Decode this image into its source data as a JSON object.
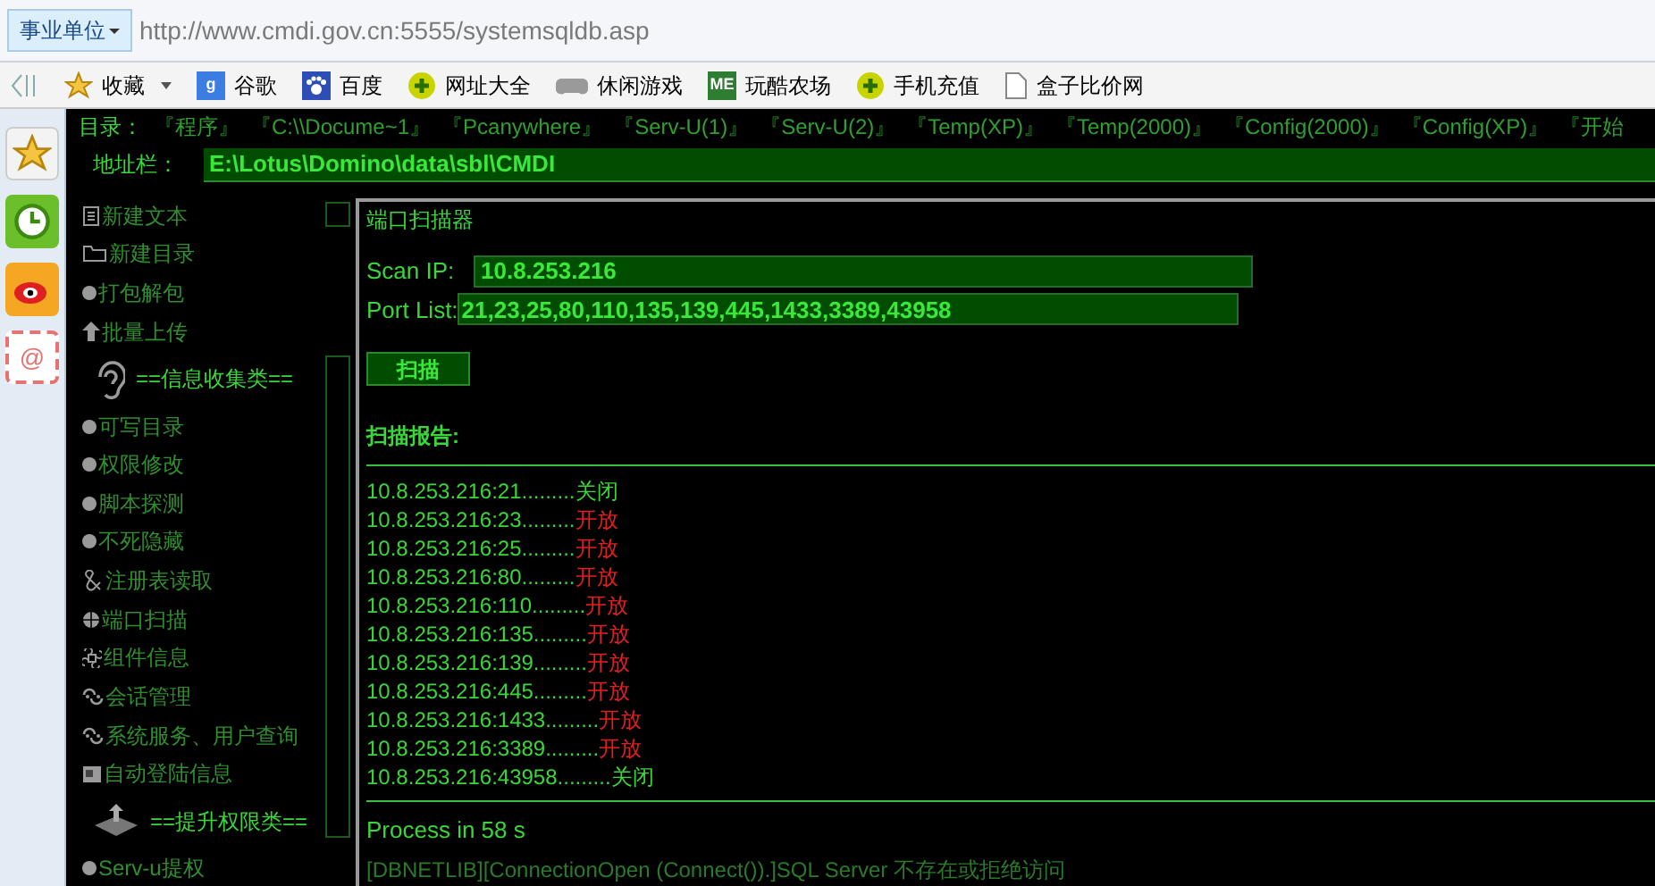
{
  "browser": {
    "zone_button": "事业单位",
    "url": "http://www.cmdi.gov.cn:5555/systemsqldb.asp",
    "bookmarks": [
      {
        "label": "收藏"
      },
      {
        "badge": "g",
        "label": "谷歌"
      },
      {
        "label": "百度"
      },
      {
        "label": "网址大全"
      },
      {
        "label": "休闲游戏"
      },
      {
        "badge": "ME",
        "label": "玩酷农场"
      },
      {
        "label": "手机充值"
      },
      {
        "label": "盒子比价网"
      }
    ]
  },
  "side_rail": {
    "mail_glyph": "@"
  },
  "directory": {
    "label": "目录：",
    "links": [
      "『程序』",
      "『C:\\\\Docume~1』",
      "『Pcanywhere』",
      "『Serv-U(1)』",
      "『Serv-U(2)』",
      "『Temp(XP)』",
      "『Temp(2000)』",
      "『Config(2000)』",
      "『Config(XP)』",
      "『开始"
    ]
  },
  "address": {
    "label": "地址栏：",
    "value": "E:\\Lotus\\Domino\\data\\sbl\\CMDI"
  },
  "sidebar": [
    {
      "kind": "item",
      "label": "新建文本"
    },
    {
      "kind": "item",
      "label": "新建目录"
    },
    {
      "kind": "item",
      "label": "打包解包"
    },
    {
      "kind": "item",
      "label": "批量上传"
    },
    {
      "kind": "header",
      "label": "==信息收集类=="
    },
    {
      "kind": "item",
      "label": "可写目录"
    },
    {
      "kind": "item",
      "label": "权限修改"
    },
    {
      "kind": "item",
      "label": "脚本探测"
    },
    {
      "kind": "item",
      "label": "不死隐藏"
    },
    {
      "kind": "item",
      "label": "注册表读取"
    },
    {
      "kind": "item",
      "label": "端口扫描"
    },
    {
      "kind": "item",
      "label": "组件信息"
    },
    {
      "kind": "item",
      "label": "会话管理"
    },
    {
      "kind": "item",
      "label": "系统服务、用户查询"
    },
    {
      "kind": "item",
      "label": "自动登陆信息"
    },
    {
      "kind": "header",
      "label": "==提升权限类=="
    },
    {
      "kind": "item",
      "label": "Serv-u提权"
    }
  ],
  "scanner": {
    "title": "端口扫描器",
    "scan_ip_label": "Scan IP:",
    "scan_ip": "10.8.253.216",
    "port_list_label": "Port List:",
    "port_list": "21,23,25,80,110,135,139,445,1433,3389,43958",
    "scan_button": "扫描",
    "report_label": "扫描报告:",
    "results": [
      {
        "target": "10.8.253.216:21.........",
        "status": "关闭",
        "kind": "closed"
      },
      {
        "target": "10.8.253.216:23.........",
        "status": "开放",
        "kind": "open"
      },
      {
        "target": "10.8.253.216:25.........",
        "status": "开放",
        "kind": "open"
      },
      {
        "target": "10.8.253.216:80.........",
        "status": "开放",
        "kind": "open"
      },
      {
        "target": "10.8.253.216:110.........",
        "status": "开放",
        "kind": "open"
      },
      {
        "target": "10.8.253.216:135.........",
        "status": "开放",
        "kind": "open"
      },
      {
        "target": "10.8.253.216:139.........",
        "status": "开放",
        "kind": "open"
      },
      {
        "target": "10.8.253.216:445.........",
        "status": "开放",
        "kind": "open"
      },
      {
        "target": "10.8.253.216:1433.........",
        "status": "开放",
        "kind": "open"
      },
      {
        "target": "10.8.253.216:3389.........",
        "status": "开放",
        "kind": "open"
      },
      {
        "target": "10.8.253.216:43958.........",
        "status": "关闭",
        "kind": "closed"
      }
    ],
    "process": "Process in 58 s",
    "error": "[DBNETLIB][ConnectionOpen (Connect()).]SQL Server 不存在或拒绝访问"
  }
}
